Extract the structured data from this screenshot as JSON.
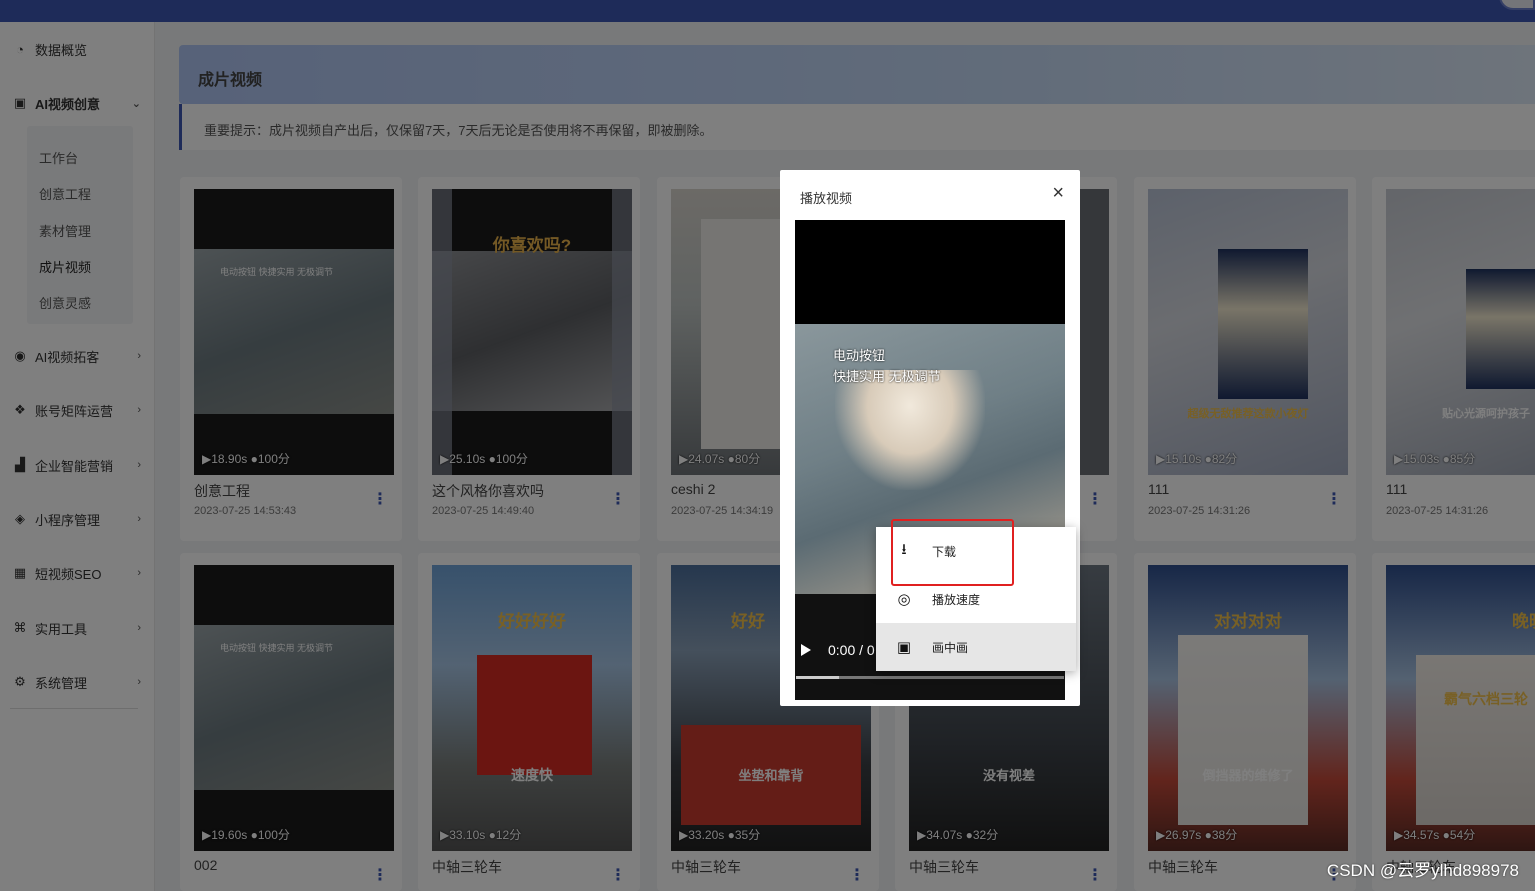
{
  "sidebar": {
    "items": [
      {
        "label": "数据概览",
        "icon": "dashboard-icon"
      },
      {
        "label": "AI视频创意",
        "icon": "image-icon",
        "expanded": true
      },
      {
        "label": "AI视频拓客",
        "icon": "globe-icon"
      },
      {
        "label": "账号矩阵运营",
        "icon": "grid-icon"
      },
      {
        "label": "企业智能营销",
        "icon": "bar-chart-icon"
      },
      {
        "label": "小程序管理",
        "icon": "compass-icon"
      },
      {
        "label": "短视频SEO",
        "icon": "table-icon"
      },
      {
        "label": "实用工具",
        "icon": "command-icon"
      },
      {
        "label": "系统管理",
        "icon": "settings-icon"
      }
    ],
    "submenu": [
      "工作台",
      "创意工程",
      "素材管理",
      "成片视频",
      "创意灵感"
    ],
    "active_sub": "成片视频"
  },
  "page": {
    "title": "成片视频",
    "notice": "重要提示：成片视频自产出后，仅保留7天，7天后无论是否使用将不再保留，即被删除。"
  },
  "cards": [
    {
      "name": "创意工程",
      "date": "2023-07-25 14:53:43",
      "duration": "18.90s",
      "score": "100分",
      "caption": "",
      "subcaption": "电动按钮 快捷实用 无极调节"
    },
    {
      "name": "这个风格你喜欢吗",
      "date": "2023-07-25 14:49:40",
      "duration": "25.10s",
      "score": "100分",
      "caption": "你喜欢吗?",
      "subcaption": ""
    },
    {
      "name": "ceshi 2",
      "date": "2023-07-25 14:34:19",
      "duration": "24.07s",
      "score": "80分",
      "caption": "",
      "subcaption": ""
    },
    {
      "name": "",
      "date": "",
      "duration": "",
      "score": "",
      "caption": "",
      "subcaption": ""
    },
    {
      "name": "111",
      "date": "2023-07-25 14:31:26",
      "duration": "15.10s",
      "score": "82分",
      "caption": "",
      "subcaption": "超级无敌推荐这款小夜灯"
    },
    {
      "name": "111",
      "date": "2023-07-25 14:31:26",
      "duration": "15.03s",
      "score": "85分",
      "caption": "",
      "subcaption": "贴心光源呵护孩子"
    },
    {
      "name": "002",
      "date": "",
      "duration": "19.60s",
      "score": "100分",
      "caption": "",
      "subcaption": "电动按钮 快捷实用 无极调节"
    },
    {
      "name": "中轴三轮车",
      "date": "",
      "duration": "33.10s",
      "score": "12分",
      "caption": "好好好好",
      "subcaption": "速度快"
    },
    {
      "name": "中轴三轮车",
      "date": "",
      "duration": "33.20s",
      "score": "35分",
      "caption": "好好",
      "subcaption": "坐垫和靠背"
    },
    {
      "name": "中轴三轮车",
      "date": "",
      "duration": "34.07s",
      "score": "32分",
      "caption": "",
      "subcaption": "没有视差"
    },
    {
      "name": "中轴三轮车",
      "date": "",
      "duration": "26.97s",
      "score": "38分",
      "caption": "对对对对",
      "subcaption": "倒挡器的维修了"
    },
    {
      "name": "中轴三轮车",
      "date": "",
      "duration": "34.57s",
      "score": "54分",
      "caption": "晚晚晚晚",
      "subcaption": "霸气六档三轮"
    }
  ],
  "modal": {
    "title": "播放视频",
    "close_label": "×",
    "caption_line1": "电动按钮",
    "caption_line2": "快捷实用 无极调节",
    "time": "0:00 / 0"
  },
  "context_menu": {
    "items": [
      {
        "label": "下载",
        "icon": "download-icon"
      },
      {
        "label": "播放速度",
        "icon": "playback-speed-icon"
      },
      {
        "label": "画中画",
        "icon": "picture-in-picture-icon"
      }
    ]
  },
  "watermark": "CSDN @云罗ylhd898978",
  "colors": {
    "primary": "#3d56b2",
    "highlight_box": "#e02020",
    "notice_border": "#3d56b2"
  }
}
